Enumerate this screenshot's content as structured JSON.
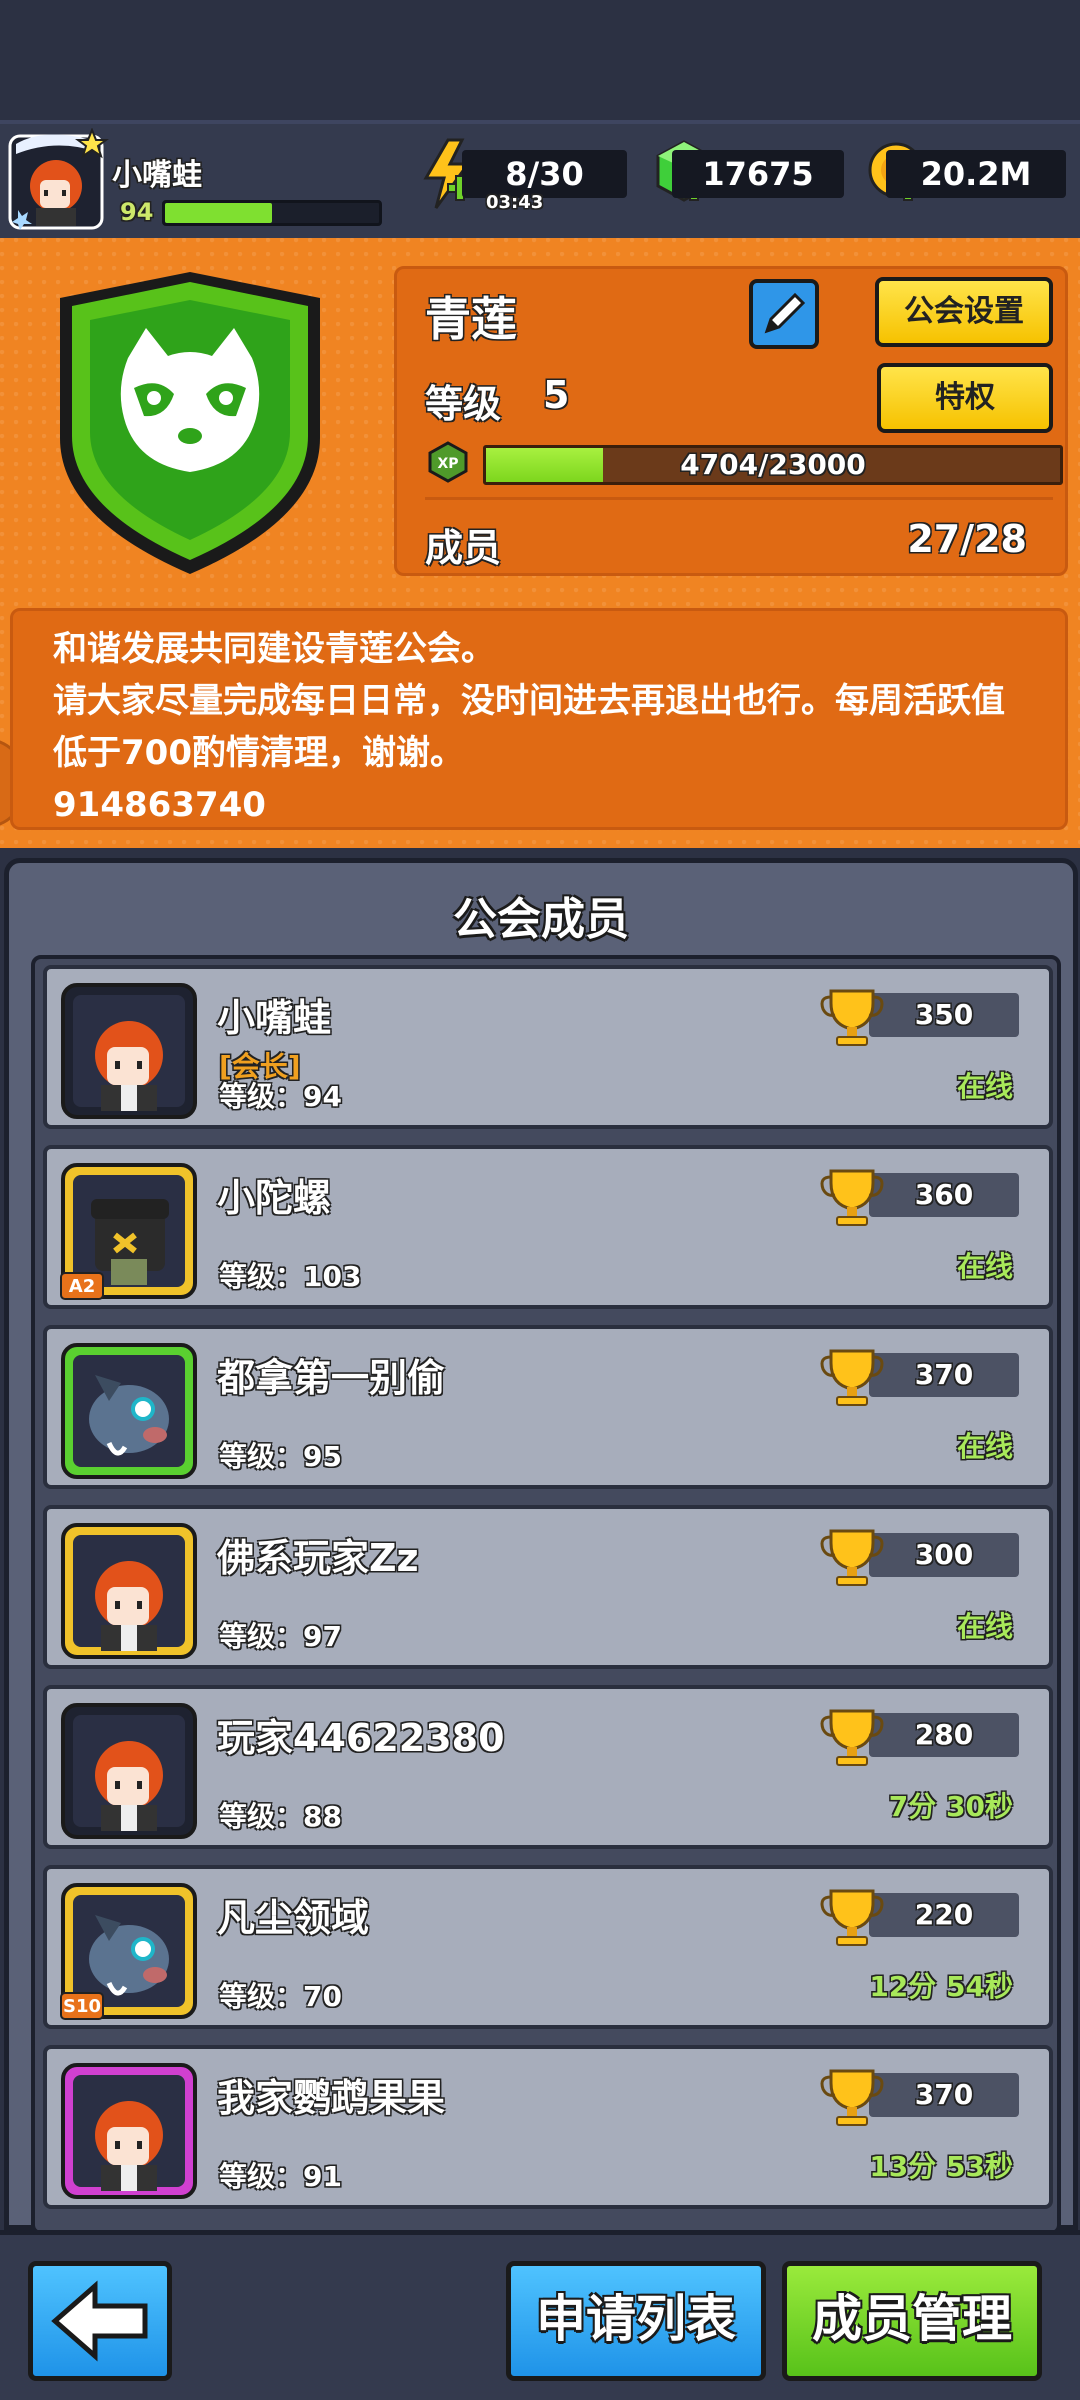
{
  "player": {
    "name": "小嘴蛙",
    "level": "94",
    "level_progress": 0.5
  },
  "resources": {
    "energy": "8/30",
    "energy_timer": "03:43",
    "gems": "17675",
    "gold": "20.2M"
  },
  "guild": {
    "name": "青莲",
    "settings_label": "公会设置",
    "privilege_label": "特权",
    "level_label": "等级",
    "level_value": "5",
    "xp_text": "4704/23000",
    "xp_progress": 0.2045,
    "xp_icon_label": "XP",
    "members_label": "成员",
    "members_count": "27/28",
    "notice": "和谐发展共同建设青莲公会。\n请大家尽量完成每日日常，没时间进去再退出也行。每周活跃值低于700酌情清理，谢谢。\n914863740"
  },
  "members_panel": {
    "title": "公会成员",
    "members": [
      {
        "name": "小嘴蛙",
        "role": "[会长]",
        "level": "等级：94",
        "score": "350",
        "status": "在线",
        "avatar": "redhair-avatar-frost-frame",
        "frame_color": "#1e2230"
      },
      {
        "name": "小陀螺",
        "role": "",
        "level": "等级：103",
        "score": "360",
        "status": "在线",
        "avatar": "pirate-avatar-gold-frame",
        "frame_color": "#f0c22a",
        "badge": "A2"
      },
      {
        "name": "都拿第一别偷",
        "role": "",
        "level": "等级：95",
        "score": "370",
        "status": "在线",
        "avatar": "boar-avatar-green-frame",
        "frame_color": "#5ad030"
      },
      {
        "name": "佛系玩家Zz",
        "role": "",
        "level": "等级：97",
        "score": "300",
        "status": "在线",
        "avatar": "redhair-avatar-crown-frame",
        "frame_color": "#f0c22a"
      },
      {
        "name": "玩家44622380",
        "role": "",
        "level": "等级：88",
        "score": "280",
        "status": "7分 30秒",
        "avatar": "redhair-avatar-frost-frame",
        "frame_color": "#1e2230"
      },
      {
        "name": "凡尘领域",
        "role": "",
        "level": "等级：70",
        "score": "220",
        "status": "12分 54秒",
        "avatar": "boar-avatar-gold-frame",
        "frame_color": "#f0c22a",
        "badge": "S10"
      },
      {
        "name": "我家鹦鹉果果",
        "role": "",
        "level": "等级：91",
        "score": "370",
        "status": "13分 53秒",
        "avatar": "redhair-avatar-purple-frame",
        "frame_color": "#d040d0"
      }
    ]
  },
  "bottom": {
    "back_icon": "arrow-left-icon",
    "apply_list_label": "申请列表",
    "member_manage_label": "成员管理"
  },
  "colors": {
    "panel_orange": "#f08422",
    "accent_green": "#7dd61e",
    "online_green": "#a8e85a",
    "button_blue": "#1f93e8",
    "button_yellow": "#f6c200"
  }
}
